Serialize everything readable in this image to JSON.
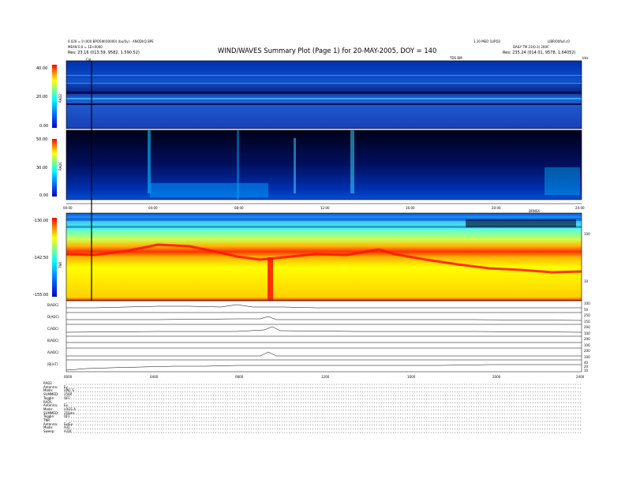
{
  "header": {
    "title": "WIND/WAVES Summary Plot (Page 1) for 20-MAY-2005, DOY = 140",
    "left_line1": "0.020 = 0 (000 BPOSW(00000) (bu/0y) - ANODI(Q BPE",
    "left_line2": "MEAN 0.0 = 1E+0000",
    "left_line3": "Res:   23.16 (013.59, 9582, 1.590.52)",
    "right_line1": "LIBR/00fa4.c0",
    "right_line2": "DAILY  TM 23(0.3)  200C",
    "right_line3": "Res:  235.24 (014.01, 9578, 1.64052)",
    "center_right": "1.10 MEO 1UPD3",
    "tr_small": "TDS BM",
    "tr_unit": "kHz",
    "cal_label": "Cal"
  },
  "panels": {
    "rad2": {
      "label": "RAD2",
      "ticks": [
        "40.00",
        "20.00",
        "0.00"
      ]
    },
    "rad1": {
      "label": "RAD1",
      "ticks": [
        "50.00",
        "30.00",
        "0.00"
      ]
    },
    "tnr": {
      "label": "TNR",
      "ticks": [
        "-130.00",
        "-142.50",
        "-155.00"
      ],
      "right_ticks": [
        "100",
        "10"
      ],
      "right_label": "DRNSX"
    }
  },
  "time_axis": {
    "ticks": [
      "00:00",
      "04:00",
      "08:00",
      "12:00",
      "16:00",
      "20:00",
      "24:00"
    ]
  },
  "lines_panels": [
    {
      "label": "B(ADC)",
      "right": [
        "100",
        "50"
      ]
    },
    {
      "label": "D(ADC)",
      "right": [
        "250",
        "150"
      ]
    },
    {
      "label": "C(ADC)",
      "right": [
        "200",
        "100"
      ]
    },
    {
      "label": "B(ADC)",
      "right": [
        "200",
        "100"
      ]
    },
    {
      "label": "A(ADC)",
      "right": [
        "200",
        "100"
      ]
    },
    {
      "label": "|B|(nT)",
      "right": [
        "40",
        "20",
        "10"
      ]
    }
  ],
  "bottom_axis": {
    "ticks": [
      "0000",
      "0400",
      "0800",
      "1200",
      "1600",
      "2000",
      "2400"
    ]
  },
  "info_block": [
    {
      "k": "RAD2",
      "v": ""
    },
    {
      "k": "Antenna:",
      "v": "Ey"
    },
    {
      "k": "Mode:",
      "v": "LIN1 S"
    },
    {
      "k": "SUMMED:",
      "v": "256P"
    },
    {
      "k": "Toggle:",
      "v": "OFF"
    },
    {
      "k": "RAD1",
      "v": ""
    },
    {
      "k": "Antenna:",
      "v": "Ex"
    },
    {
      "k": "Mode:",
      "v": "LOGS A"
    },
    {
      "k": "SUMMED:",
      "v": "256ms"
    },
    {
      "k": "Toggle:",
      "v": "OFF"
    },
    {
      "k": "TNR",
      "v": ""
    },
    {
      "k": "Antenna:",
      "v": "Ex/Ey"
    },
    {
      "k": "Mode:",
      "v": "A-D"
    },
    {
      "k": "Sweep:",
      "v": "A-D4"
    }
  ],
  "chart_data": {
    "type": "heatmap",
    "title": "WIND/WAVES Summary Plot (Page 1) for 20-MAY-2005, DOY = 140",
    "xlabel": "",
    "x_range": [
      "00:00",
      "24:00"
    ],
    "panels": [
      {
        "name": "RAD2",
        "colorbar_range": [
          0,
          40
        ]
      },
      {
        "name": "RAD1",
        "colorbar_range": [
          0,
          50
        ]
      },
      {
        "name": "TNR",
        "colorbar_range": [
          -155,
          -130
        ]
      }
    ],
    "colors": {
      "low": "#0000c8",
      "mid": "#00ffff",
      "high": "#ff0000",
      "cal_line": "#000000"
    }
  }
}
